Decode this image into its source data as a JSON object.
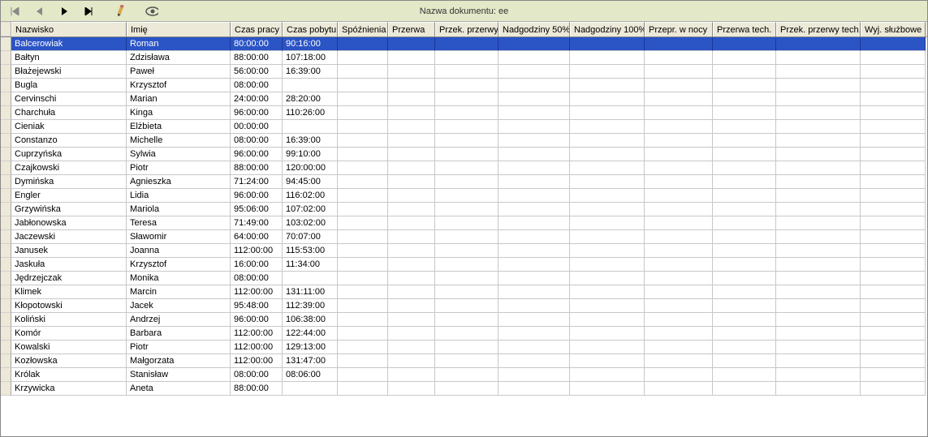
{
  "toolbar": {
    "doc_title": "Nazwa dokumentu: ee"
  },
  "columns": [
    {
      "key": "nazwisko",
      "label": "Nazwisko"
    },
    {
      "key": "imie",
      "label": "Imię"
    },
    {
      "key": "czaspracy",
      "label": "Czas pracy"
    },
    {
      "key": "czaspobytu",
      "label": "Czas pobytu"
    },
    {
      "key": "spoznienia",
      "label": "Spóźnienia"
    },
    {
      "key": "przerwa",
      "label": "Przerwa"
    },
    {
      "key": "przekprzerwy",
      "label": "Przek. przerwy"
    },
    {
      "key": "nadg50",
      "label": "Nadgodziny 50%"
    },
    {
      "key": "nadg100",
      "label": "Nadgodziny 100%"
    },
    {
      "key": "przeprwnocy",
      "label": "Przepr. w nocy"
    },
    {
      "key": "przerwatech",
      "label": "Przerwa tech."
    },
    {
      "key": "przekprzerwytech",
      "label": "Przek. przerwy tech."
    },
    {
      "key": "wyjsluzbowe",
      "label": "Wyj. służbowe"
    }
  ],
  "rows": [
    {
      "nazwisko": "Balcerowiak",
      "imie": "Roman",
      "czaspracy": "80:00:00",
      "czaspobytu": "90:16:00",
      "selected": true
    },
    {
      "nazwisko": "Bałtyn",
      "imie": "Zdzisława",
      "czaspracy": "88:00:00",
      "czaspobytu": "107:18:00"
    },
    {
      "nazwisko": "Błażejewski",
      "imie": "Paweł",
      "czaspracy": "56:00:00",
      "czaspobytu": "16:39:00"
    },
    {
      "nazwisko": "Bugla",
      "imie": "Krzysztof",
      "czaspracy": "08:00:00",
      "czaspobytu": ""
    },
    {
      "nazwisko": "Cervinschi",
      "imie": "Marian",
      "czaspracy": "24:00:00",
      "czaspobytu": "28:20:00"
    },
    {
      "nazwisko": "Charchuła",
      "imie": "Kinga",
      "czaspracy": "96:00:00",
      "czaspobytu": "110:26:00"
    },
    {
      "nazwisko": "Cieniak",
      "imie": "Elżbieta",
      "czaspracy": "00:00:00",
      "czaspobytu": ""
    },
    {
      "nazwisko": "Constanzo",
      "imie": "Michelle",
      "czaspracy": "08:00:00",
      "czaspobytu": "16:39:00"
    },
    {
      "nazwisko": "Cuprzyńska",
      "imie": "Sylwia",
      "czaspracy": "96:00:00",
      "czaspobytu": "99:10:00"
    },
    {
      "nazwisko": "Czajkowski",
      "imie": "Piotr",
      "czaspracy": "88:00:00",
      "czaspobytu": "120:00:00"
    },
    {
      "nazwisko": "Dymińska",
      "imie": "Agnieszka",
      "czaspracy": "71:24:00",
      "czaspobytu": "94:45:00"
    },
    {
      "nazwisko": "Engler",
      "imie": "Lidia",
      "czaspracy": "96:00:00",
      "czaspobytu": "116:02:00"
    },
    {
      "nazwisko": "Grzywińska",
      "imie": "Mariola",
      "czaspracy": "95:06:00",
      "czaspobytu": "107:02:00"
    },
    {
      "nazwisko": "Jabłonowska",
      "imie": "Teresa",
      "czaspracy": "71:49:00",
      "czaspobytu": "103:02:00"
    },
    {
      "nazwisko": "Jaczewski",
      "imie": "Sławomir",
      "czaspracy": "64:00:00",
      "czaspobytu": "70:07:00"
    },
    {
      "nazwisko": "Janusek",
      "imie": "Joanna",
      "czaspracy": "112:00:00",
      "czaspobytu": "115:53:00"
    },
    {
      "nazwisko": "Jaskuła",
      "imie": "Krzysztof",
      "czaspracy": "16:00:00",
      "czaspobytu": "11:34:00"
    },
    {
      "nazwisko": "Jędrzejczak",
      "imie": "Monika",
      "czaspracy": "08:00:00",
      "czaspobytu": ""
    },
    {
      "nazwisko": "Klimek",
      "imie": "Marcin",
      "czaspracy": "112:00:00",
      "czaspobytu": "131:11:00"
    },
    {
      "nazwisko": "Kłopotowski",
      "imie": "Jacek",
      "czaspracy": "95:48:00",
      "czaspobytu": "112:39:00"
    },
    {
      "nazwisko": "Koliński",
      "imie": "Andrzej",
      "czaspracy": "96:00:00",
      "czaspobytu": "106:38:00"
    },
    {
      "nazwisko": "Komór",
      "imie": "Barbara",
      "czaspracy": "112:00:00",
      "czaspobytu": "122:44:00"
    },
    {
      "nazwisko": "Kowalski",
      "imie": "Piotr",
      "czaspracy": "112:00:00",
      "czaspobytu": "129:13:00"
    },
    {
      "nazwisko": "Kozłowska",
      "imie": "Małgorzata",
      "czaspracy": "112:00:00",
      "czaspobytu": "131:47:00"
    },
    {
      "nazwisko": "Królak",
      "imie": "Stanisław",
      "czaspracy": "08:00:00",
      "czaspobytu": "08:06:00"
    },
    {
      "nazwisko": "Krzywicka",
      "imie": "Aneta",
      "czaspracy": "88:00:00",
      "czaspobytu": ""
    }
  ]
}
